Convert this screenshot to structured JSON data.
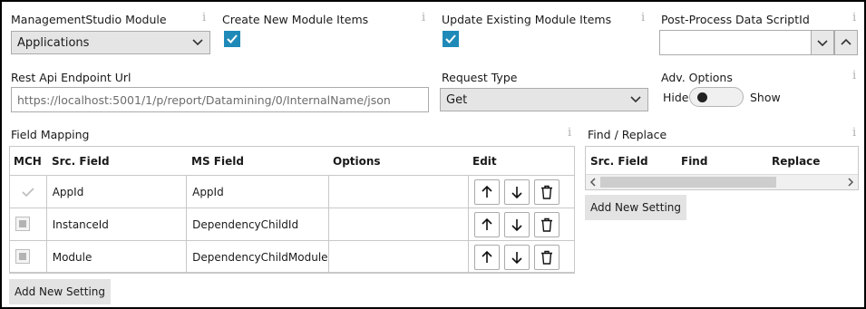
{
  "module": {
    "label": "ManagementStudio Module",
    "value": "Applications"
  },
  "create_new": {
    "label": "Create New Module Items",
    "checked": true
  },
  "update_existing": {
    "label": "Update Existing Module Items",
    "checked": true
  },
  "post_process": {
    "label": "Post-Process Data ScriptId",
    "value": ""
  },
  "rest_api": {
    "label": "Rest Api Endpoint Url",
    "value": "https://localhost:5001/1/p/report/Datamining/0/InternalName/json"
  },
  "request_type": {
    "label": "Request Type",
    "value": "Get"
  },
  "adv_options": {
    "label": "Adv. Options",
    "off_label": "Hide",
    "on_label": "Show"
  },
  "info_glyph": "i",
  "field_mapping": {
    "title": "Field Mapping",
    "columns": [
      "MCH",
      "Src. Field",
      "MS Field",
      "Options",
      "Edit"
    ],
    "rows": [
      {
        "src": "AppId",
        "ms": "AppId",
        "options": "",
        "mch": "check-disabled"
      },
      {
        "src": "InstanceId",
        "ms": "DependencyChildId",
        "options": "",
        "mch": "indeterminate"
      },
      {
        "src": "Module",
        "ms": "DependencyChildModule",
        "options": "",
        "mch": "indeterminate"
      }
    ],
    "add_button": "Add New Setting"
  },
  "find_replace": {
    "title": "Find / Replace",
    "columns": [
      "Src. Field",
      "Find",
      "Replace"
    ],
    "add_button": "Add New Setting"
  },
  "colors": {
    "accent": "#1f8ab8",
    "border": "#ababab"
  }
}
